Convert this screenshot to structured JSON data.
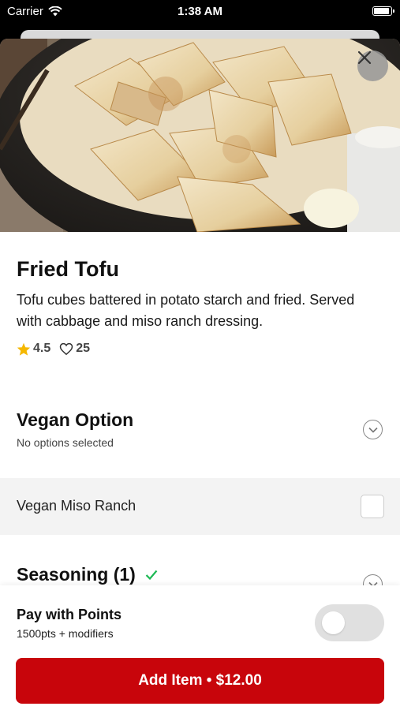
{
  "status_bar": {
    "carrier": "Carrier",
    "time": "1:38 AM"
  },
  "item": {
    "title": "Fried Tofu",
    "description": "Tofu cubes battered in potato starch and fried. Served with cabbage and miso ranch dressing.",
    "rating": "4.5",
    "likes": "25"
  },
  "sections": {
    "vegan": {
      "title": "Vegan Option",
      "subtitle": "No options selected",
      "option_label": "Vegan Miso Ranch"
    },
    "seasoning": {
      "title": "Seasoning (1)"
    }
  },
  "footer": {
    "points_title": "Pay with Points",
    "points_subtitle": "1500pts + modifiers",
    "toggle_on": false,
    "add_button_label": "Add Item • $12.00"
  },
  "colors": {
    "brand_red": "#c8050b",
    "check_green": "#1db954",
    "star_yellow": "#f5b800"
  },
  "icons": [
    "wifi-icon",
    "battery-icon",
    "close-icon",
    "star-icon",
    "heart-icon",
    "chevron-down-icon",
    "checkmark-icon"
  ]
}
